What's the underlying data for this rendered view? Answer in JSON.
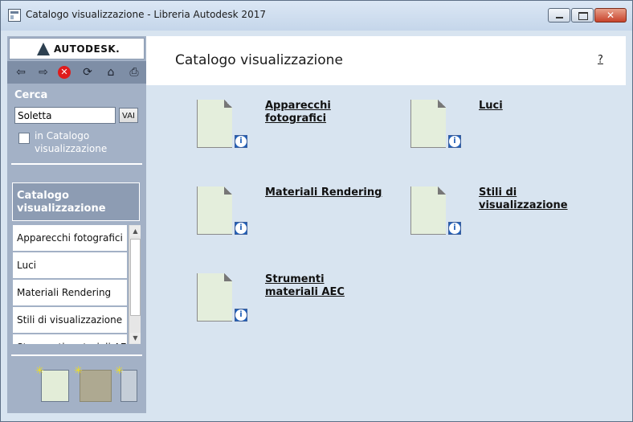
{
  "window": {
    "title": "Catalogo visualizzazione - Libreria Autodesk 2017",
    "controls": {
      "close": "✕"
    }
  },
  "sidebar": {
    "logo_text": "AUTODESK.",
    "toolbar": {
      "back": "⇦",
      "forward": "⇨",
      "stop": "✕",
      "refresh": "⟳",
      "home": "⌂",
      "print": "⎙"
    },
    "search": {
      "label": "Cerca",
      "value": "Soletta",
      "go_label": "VAI",
      "scope_label": "in Catalogo visualizzazione",
      "scope_checked": false
    },
    "catalog_header": "Catalogo visualizzazione",
    "categories": [
      "Apparecchi fotografici",
      "Luci",
      "Materiali Rendering",
      "Stili di visualizzazione",
      "Strumenti materiali AEC"
    ],
    "scroll": {
      "up": "▲",
      "down": "▼"
    },
    "bottom_tools_spark": "✳"
  },
  "main": {
    "title": "Catalogo visualizzazione",
    "help": "?",
    "items": [
      {
        "label": "Apparecchi fotografici"
      },
      {
        "label": "Luci"
      },
      {
        "label": "Materiali Rendering"
      },
      {
        "label": "Stili di visualizzazione"
      },
      {
        "label": "Strumenti materiali AEC"
      }
    ]
  },
  "colors": {
    "sidebar_bg": "#a3b1c6",
    "toolbar_bg": "#7e8ea6",
    "main_bg": "#d8e4f0",
    "doc_fill": "#e4eedc",
    "info_blue": "#1f5fb8",
    "stop_red": "#e01b1b"
  },
  "icons": {
    "app": "catalog-window-icon",
    "logo": "autodesk-logo-icon",
    "category_doc": "document-icon",
    "info": "info-icon"
  }
}
